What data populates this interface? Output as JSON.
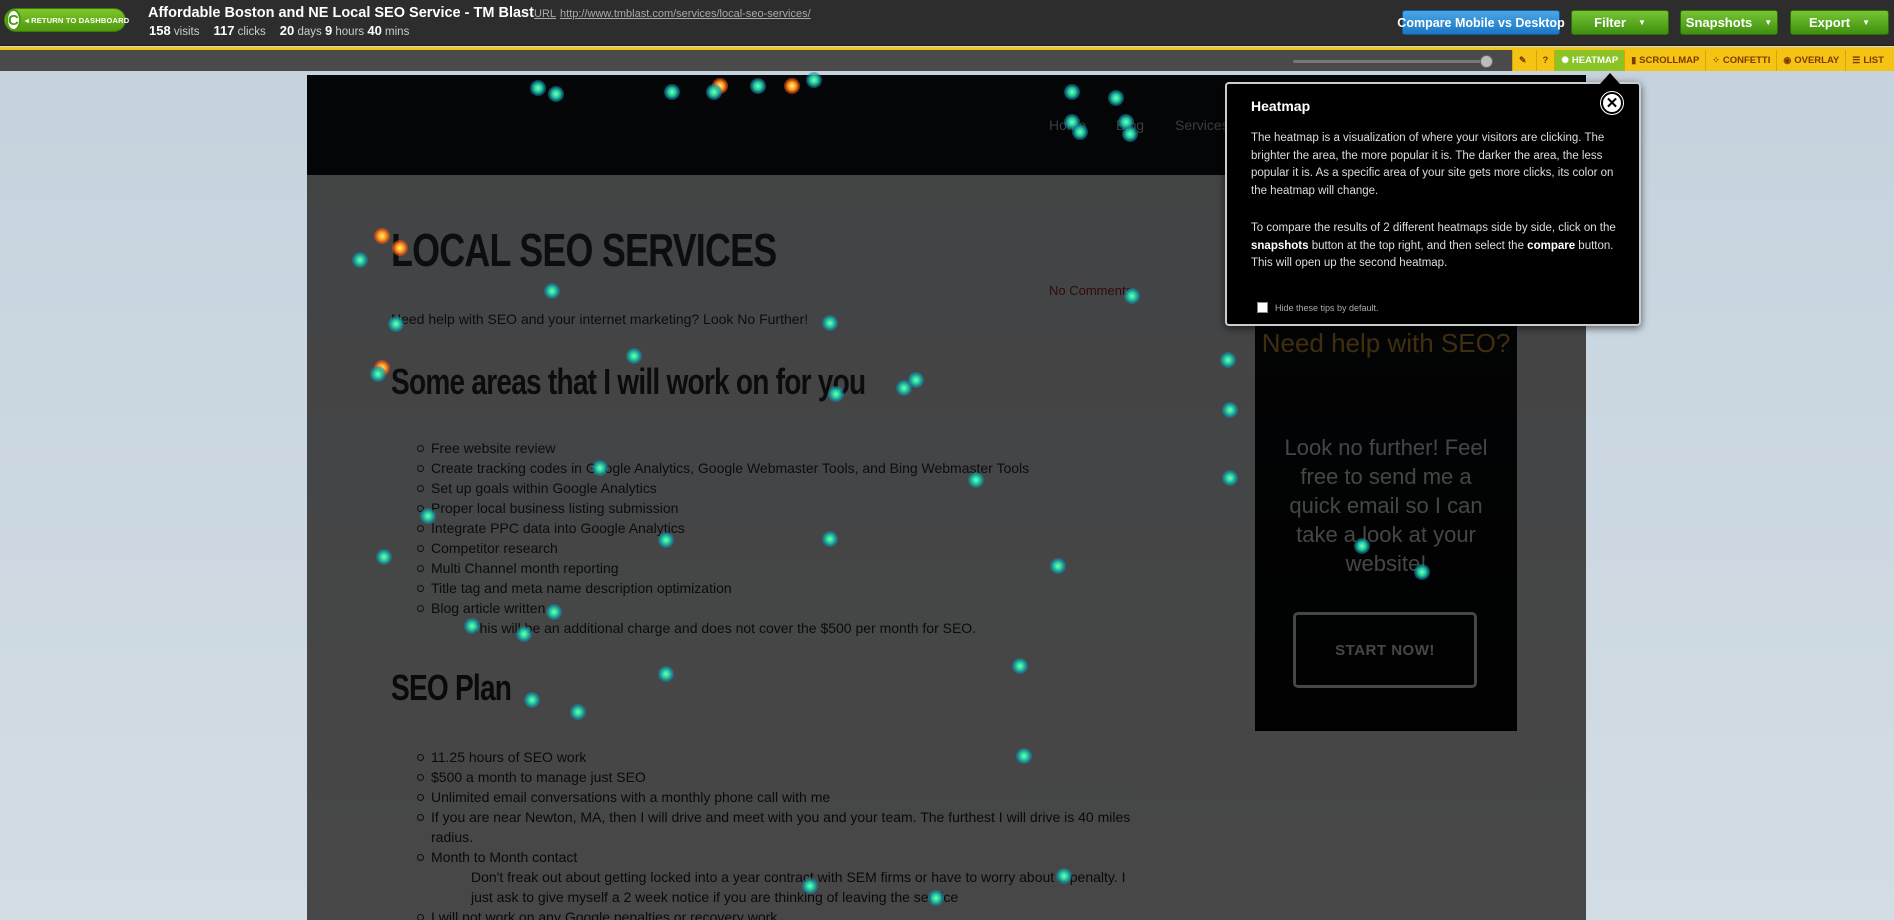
{
  "topbar": {
    "return_label": "RETURN TO DASHBOARD",
    "logo_letter": "C",
    "title": "Affordable Boston and NE Local SEO Service - TM Blast",
    "url_label": "URL",
    "url": "http://www.tmblast.com/services/local-seo-services/",
    "visits_value": "158",
    "visits_label": "visits",
    "clicks_value": "117",
    "clicks_label": "clicks",
    "days_value": "20",
    "days_label": "days",
    "hours_value": "9",
    "hours_label": "hours",
    "mins_value": "40",
    "mins_label": "mins",
    "compare_label": "Compare Mobile vs Desktop",
    "filter_label": "Filter",
    "snapshots_label": "Snapshots",
    "export_label": "Export",
    "colors": {
      "compare": "#1b76c4",
      "green": "#4f9a0f"
    }
  },
  "toolbar": {
    "edit_icon": "edit-icon",
    "help_label": "?",
    "heatmap_label": "HEATMAP",
    "scrollmap_label": "SCROLLMAP",
    "confetti_label": "CONFETTI",
    "overlay_label": "OVERLAY",
    "list_label": "LIST",
    "accent": "#f4c414"
  },
  "site": {
    "nav": [
      "Home",
      "Blog",
      "Services"
    ],
    "heading1": "LOCAL SEO SERVICES",
    "no_comments": "No Comments",
    "intro": "Need help with SEO and your internet marketing? Look No Further!",
    "heading2": "Some areas that I will work on for you",
    "list1": [
      "Free website review",
      "Create tracking codes in Google Analytics, Google Webmaster Tools, and Bing Webmaster Tools",
      "Set up goals within Google Analytics",
      "Proper local business listing submission",
      "Integrate PPC data into Google Analytics",
      "Competitor research",
      "Multi Channel month reporting",
      "Title tag and meta name description optimization",
      "Blog article written"
    ],
    "list1_sub": "This will be an additional charge and does not cover the $500 per month for SEO.",
    "heading3": "SEO Plan",
    "list2": [
      "11.25 hours of SEO work",
      "$500 a month to manage just SEO",
      "Unlimited email conversations with a monthly phone call with me",
      "If you are near Newton, MA, then I will drive and meet with you and your team. The furthest I will drive is 40 miles radius.",
      "Month to Month contact"
    ],
    "list2_sub": "Don't freak out about getting locked into a year contract with SEM firms or have to worry about a penalty. I just ask to give myself a 2 week notice if you are thinking of leaving the service",
    "list2_last": "I will not work on any Google penalties or recovery work",
    "sidebar_title": "Need help with SEO?",
    "sidebar_text": "Look no further! Feel free to send me a quick email so I can take a look at your website!",
    "sidebar_button": "START NOW!"
  },
  "tooltip": {
    "title": "Heatmap",
    "p1": "The heatmap is a visualization of where your visitors are clicking. The brighter the area, the more popular it is. The darker the area, the less popular it is. As a specific area of your site gets more clicks, its color on the heatmap will change.",
    "p2_a": "To compare the results of 2 different heatmaps side by side, click on the ",
    "p2_b": "snapshots",
    "p2_c": " button at the top right, and then select the ",
    "p2_d": "compare",
    "p2_e": " button. This will open up the second heatmap.",
    "hide_label": "Hide these tips by default.",
    "hide_checked": false,
    "close_icon": "close-icon"
  }
}
